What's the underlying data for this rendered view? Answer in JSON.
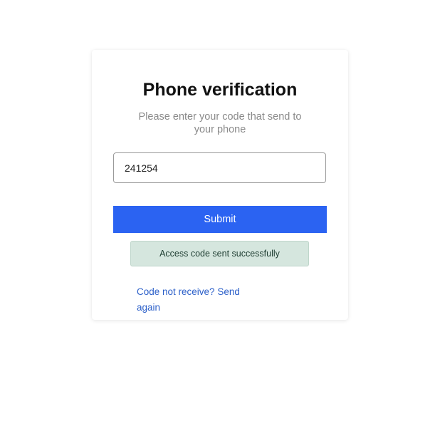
{
  "verification": {
    "title": "Phone verification",
    "subtitle": "Please enter your code that send to your phone",
    "code_value": "241254",
    "submit_label": "Submit",
    "alert_message": "Access code sent successfully",
    "resend_link": "Code not receive? Send again"
  },
  "colors": {
    "primary_button": "#2b63f2",
    "alert_background": "#d5e6de",
    "link": "#2b5fc9"
  }
}
